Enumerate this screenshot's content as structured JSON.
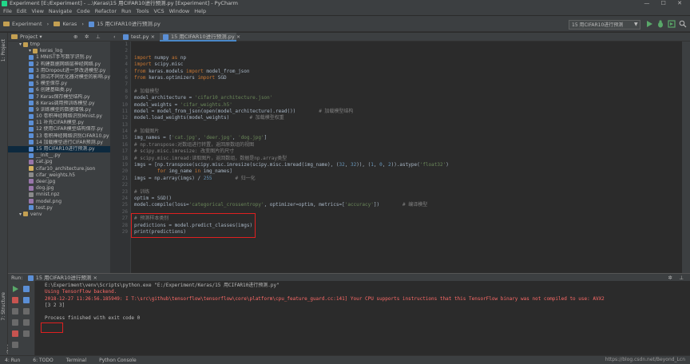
{
  "window": {
    "title": "Experiment [E:/Experiment] - ...\\Keras\\15 用CIFAR10进行预测.py [Experiment] - PyCharm",
    "controls": "— ☐ ✕"
  },
  "menu": [
    "File",
    "Edit",
    "View",
    "Navigate",
    "Code",
    "Refactor",
    "Run",
    "Tools",
    "VCS",
    "Window",
    "Help"
  ],
  "breadcrumbs": [
    "Experiment",
    "Keras",
    "15 用CIFAR10进行预测.py"
  ],
  "run_config": "15 用CIFAR10进行预测",
  "project_panel": {
    "title": "Project"
  },
  "tree": [
    {
      "label": "tmp",
      "type": "folder",
      "indent": 1
    },
    {
      "label": "keras_log",
      "type": "folder",
      "indent": 2
    },
    {
      "label": "1 MNIST手写数字识别.py",
      "type": "py",
      "indent": 2
    },
    {
      "label": "2 构建数据网络层神经网络.py",
      "type": "py",
      "indent": 2
    },
    {
      "label": "3 用Dropout进一步改进模型.py",
      "type": "py",
      "indent": 2
    },
    {
      "label": "4 测试不同优化器对模型的影响.py",
      "type": "py",
      "indent": 2
    },
    {
      "label": "5 模型保存.py",
      "type": "py",
      "indent": 2
    },
    {
      "label": "6 创建基础类.py",
      "type": "py",
      "indent": 2
    },
    {
      "label": "7 Keras保存模型结构.py",
      "type": "py",
      "indent": 2
    },
    {
      "label": "8 Keras调用预训练模型.py",
      "type": "py",
      "indent": 2
    },
    {
      "label": "9 训练模型的数据增强.py",
      "type": "py",
      "indent": 2
    },
    {
      "label": "10 卷积神经网络识别Mnist.py",
      "type": "py",
      "indent": 2
    },
    {
      "label": "11 补充CIFAR模型.py",
      "type": "py",
      "indent": 2
    },
    {
      "label": "12 使用CIFAR模型结构保存.py",
      "type": "py",
      "indent": 2
    },
    {
      "label": "13 卷积神经网络识别CIFAR10.py",
      "type": "py",
      "indent": 2
    },
    {
      "label": "14 加载模型进行CIFAR预测.py",
      "type": "py",
      "indent": 2
    },
    {
      "label": "15 用CIFAR10进行预测.py",
      "type": "py",
      "indent": 2,
      "selected": true
    },
    {
      "label": "__init__.py",
      "type": "py",
      "indent": 2
    },
    {
      "label": "cat.jpg",
      "type": "img",
      "indent": 2
    },
    {
      "label": "cifar10_architecture.json",
      "type": "json",
      "indent": 2
    },
    {
      "label": "cifar_weights.h5",
      "type": "file",
      "indent": 2
    },
    {
      "label": "deer.jpg",
      "type": "img",
      "indent": 2
    },
    {
      "label": "dog.jpg",
      "type": "img",
      "indent": 2
    },
    {
      "label": "mnist.npz",
      "type": "file",
      "indent": 2
    },
    {
      "label": "model.png",
      "type": "img",
      "indent": 2
    },
    {
      "label": "test.py",
      "type": "py",
      "indent": 2
    },
    {
      "label": "venv",
      "type": "folder",
      "indent": 1
    }
  ],
  "tabs": [
    "test.py",
    "15 用CIFAR10进行预测.py"
  ],
  "code_lines": [
    [],
    [],
    [
      [
        "kw",
        "import "
      ],
      [
        "t",
        "numpy "
      ],
      [
        "kw",
        "as "
      ],
      [
        "t",
        "np"
      ]
    ],
    [
      [
        "kw",
        "import "
      ],
      [
        "t",
        "scipy.misc"
      ]
    ],
    [
      [
        "kw",
        "from "
      ],
      [
        "t",
        "keras.models "
      ],
      [
        "kw",
        "import "
      ],
      [
        "t",
        "model_from_json"
      ]
    ],
    [
      [
        "kw",
        "from "
      ],
      [
        "t",
        "keras.optimizers "
      ],
      [
        "kw",
        "import "
      ],
      [
        "t",
        "SGD"
      ]
    ],
    [],
    [
      [
        "cm",
        "# 加载模型"
      ]
    ],
    [
      [
        "t",
        "model_architecture = "
      ],
      [
        "st",
        "'cifar10_architecture.json'"
      ]
    ],
    [
      [
        "t",
        "model_weights = "
      ],
      [
        "st",
        "'cifar_weights.h5'"
      ]
    ],
    [
      [
        "t",
        "model = model_from_json(open(model_architecture).read())        "
      ],
      [
        "cm",
        "# 加载模型结构"
      ]
    ],
    [
      [
        "t",
        "model.load_weights(model_weights)       "
      ],
      [
        "cm",
        "# 加载模型权重"
      ]
    ],
    [],
    [
      [
        "cm",
        "# 加载图片"
      ]
    ],
    [
      [
        "t",
        "img_names = ["
      ],
      [
        "st",
        "'cat.jpg'"
      ],
      [
        "t",
        ", "
      ],
      [
        "st",
        "'deer.jpg'"
      ],
      [
        "t",
        ", "
      ],
      [
        "st",
        "'dog.jpg'"
      ],
      [
        "t",
        "]"
      ]
    ],
    [
      [
        "cm",
        "# np.transpose:对数组进行转置，返回原数组的视图"
      ]
    ],
    [
      [
        "cm",
        "# scipy.misc.imresize: 改变图片的尺寸"
      ]
    ],
    [
      [
        "cm",
        "# scipy.misc.imread:读取图片，返回数组，数据是np.array类型"
      ]
    ],
    [
      [
        "t",
        "imgs = [np.transpose(scipy.misc.imresize(scipy.misc.imread(img_name), ("
      ],
      [
        "nb",
        "32"
      ],
      [
        "t",
        ", "
      ],
      [
        "nb",
        "32"
      ],
      [
        "t",
        ")), ("
      ],
      [
        "nb",
        "1"
      ],
      [
        "t",
        ", "
      ],
      [
        "nb",
        "0"
      ],
      [
        "t",
        ", "
      ],
      [
        "nb",
        "2"
      ],
      [
        "t",
        ")).astype("
      ],
      [
        "st",
        "'float32'"
      ],
      [
        "t",
        ")"
      ]
    ],
    [
      [
        "t",
        "        "
      ],
      [
        "kw",
        "for "
      ],
      [
        "t",
        "img_name "
      ],
      [
        "kw",
        "in "
      ],
      [
        "t",
        "img_names]"
      ]
    ],
    [
      [
        "t",
        "imgs = np.array(imgs) / "
      ],
      [
        "nb",
        "255"
      ],
      [
        "t",
        "        "
      ],
      [
        "cm",
        "# 归一化"
      ]
    ],
    [],
    [
      [
        "cm",
        "# 训练"
      ]
    ],
    [
      [
        "t",
        "optim = SGD()"
      ]
    ],
    [
      [
        "t",
        "model.compile(loss="
      ],
      [
        "st",
        "'categorical_crossentropy'"
      ],
      [
        "t",
        ", optimizer=optim, metrics=["
      ],
      [
        "st",
        "'accuracy'"
      ],
      [
        "t",
        "])        "
      ],
      [
        "cm",
        "# 编译模型"
      ]
    ],
    [],
    [
      [
        "cm",
        "# 预测样本类别"
      ]
    ],
    [
      [
        "t",
        "predictions = model.predict_classes(imgs)"
      ]
    ],
    [
      [
        "t",
        "print(predictions)"
      ]
    ]
  ],
  "run_panel": {
    "label": "Run:",
    "config": "15 用CIFAR10进行预测"
  },
  "console_lines": [
    {
      "cls": "",
      "text": "E:\\Experiment\\venv\\Scripts\\python.exe \"E:/Experiment/Keras/15 用CIFAR10进行预测.py\""
    },
    {
      "cls": "err",
      "text": "Using TensorFlow backend."
    },
    {
      "cls": "err",
      "text": "2018-12-27 11:26:56.185949: I T:\\src\\github\\tensorflow\\tensorflow\\core\\platform\\cpu_feature_guard.cc:141] Your CPU supports instructions that this TensorFlow binary was not compiled to use: AVX2"
    },
    {
      "cls": "",
      "text": "[3 2 3]"
    },
    {
      "cls": "",
      "text": ""
    },
    {
      "cls": "",
      "text": "Process finished with exit code 0"
    }
  ],
  "bottom_tools": [
    "4: Run",
    "6: TODO",
    "Terminal",
    "Python Console"
  ],
  "watermark": "https://blog.csdn.net/Beyond_Lcn",
  "colors": {
    "highlight_box": "#e02020",
    "selection": "#0d293e",
    "accent": "#4a88c7"
  }
}
